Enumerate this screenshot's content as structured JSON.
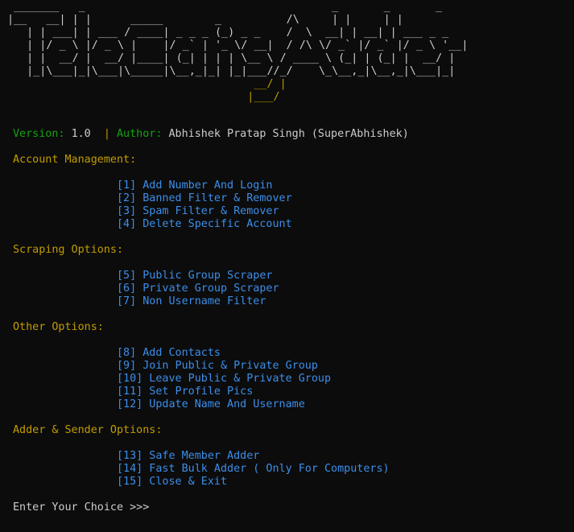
{
  "banner": {
    "lines": [
      " _______   _                                      _       _       _ ",
      "|__   __| | |      _____        _          /\\     | |     | |      ",
      "   | | ___| | ___ / ____| _ _ _ (_) _ _    /  \\  __| | __| | ___ _ _",
      "   | |/ _ \\ |/ _ \\ |    |/ _` | '_ \\/ __|  / /\\ \\/ _` |/ _` |/ _ \\ '__|",
      "   | |  __/ |  __/ |____| (_| | | | \\__ \\ / ____ \\ (_| | (_| |  __/ |",
      "   |_|\\___|_|\\___|\\_____|\\__,_|_| |_|___//_/    \\_\\__,_|\\__,_|\\___|_|",
      "                                      __/ |",
      "                                     |___/"
    ]
  },
  "info": {
    "version_label": "Version:",
    "version_value": "1.0",
    "separator": "|",
    "author_label": "Author:",
    "author_value": "Abhishek Pratap Singh (SuperAbhishek)"
  },
  "sections": {
    "account": {
      "heading": "Account Management:",
      "items": [
        "[1] Add Number And Login",
        "[2] Banned Filter & Remover",
        "[3] Spam Filter & Remover",
        "[4] Delete Specific Account"
      ]
    },
    "scraping": {
      "heading": "Scraping Options:",
      "items": [
        "[5] Public Group Scraper",
        "[6] Private Group Scraper",
        "[7] Non Username Filter"
      ]
    },
    "other": {
      "heading": "Other Options:",
      "items": [
        "[8] Add Contacts",
        "[9] Join Public & Private Group",
        "[10] Leave Public & Private Group",
        "[11] Set Profile Pics",
        "[12] Update Name And Username"
      ]
    },
    "adder": {
      "heading": "Adder & Sender Options:",
      "items": [
        "[13] Safe Member Adder",
        "[14] Fast Bulk Adder ( Only For Computers)",
        "[15] Close & Exit"
      ]
    }
  },
  "prompt": "Enter Your Choice >>> ",
  "colors": {
    "background": "#0c0c0c",
    "green": "#13a10e",
    "yellow": "#c19c00",
    "blue": "#3b8eea",
    "white": "#cccccc"
  }
}
